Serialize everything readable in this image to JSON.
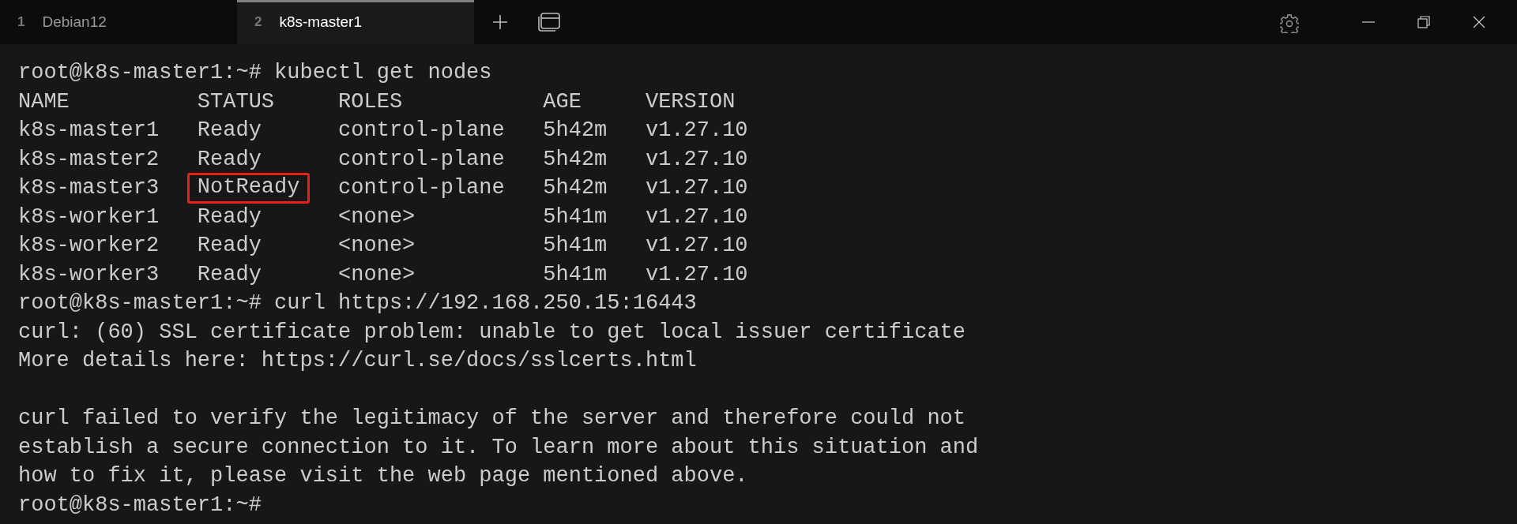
{
  "tabs": [
    {
      "number": "1",
      "title": "Debian12",
      "selected": false
    },
    {
      "number": "2",
      "title": "k8s-master1",
      "selected": true
    }
  ],
  "terminal": {
    "lines": [
      {
        "kind": "text",
        "segments": [
          {
            "text": "root@k8s-master1:~# kubectl get nodes",
            "highlighted": false
          }
        ]
      },
      {
        "kind": "text",
        "segments": [
          {
            "text": "NAME          STATUS     ROLES           AGE     VERSION",
            "highlighted": false
          }
        ]
      },
      {
        "kind": "text",
        "segments": [
          {
            "text": "k8s-master1   Ready      control-plane   5h42m   v1.27.10",
            "highlighted": false
          }
        ]
      },
      {
        "kind": "text",
        "segments": [
          {
            "text": "k8s-master2   Ready      control-plane   5h42m   v1.27.10",
            "highlighted": false
          }
        ]
      },
      {
        "kind": "text",
        "segments": [
          {
            "text": "k8s-master3   ",
            "highlighted": false
          },
          {
            "text": "NotReady",
            "highlighted": true
          },
          {
            "text": "   control-plane   5h42m   v1.27.10",
            "highlighted": false
          }
        ]
      },
      {
        "kind": "text",
        "segments": [
          {
            "text": "k8s-worker1   Ready      <none>          5h41m   v1.27.10",
            "highlighted": false
          }
        ]
      },
      {
        "kind": "text",
        "segments": [
          {
            "text": "k8s-worker2   Ready      <none>          5h41m   v1.27.10",
            "highlighted": false
          }
        ]
      },
      {
        "kind": "text",
        "segments": [
          {
            "text": "k8s-worker3   Ready      <none>          5h41m   v1.27.10",
            "highlighted": false
          }
        ]
      },
      {
        "kind": "text",
        "segments": [
          {
            "text": "root@k8s-master1:~# curl https://192.168.250.15:16443",
            "highlighted": false
          }
        ]
      },
      {
        "kind": "text",
        "segments": [
          {
            "text": "curl: (60) SSL certificate problem: unable to get local issuer certificate",
            "highlighted": false
          }
        ]
      },
      {
        "kind": "text",
        "segments": [
          {
            "text": "More details here: https://curl.se/docs/sslcerts.html",
            "highlighted": false
          }
        ]
      },
      {
        "kind": "blank"
      },
      {
        "kind": "text",
        "segments": [
          {
            "text": "curl failed to verify the legitimacy of the server and therefore could not",
            "highlighted": false
          }
        ]
      },
      {
        "kind": "text",
        "segments": [
          {
            "text": "establish a secure connection to it. To learn more about this situation and",
            "highlighted": false
          }
        ]
      },
      {
        "kind": "text",
        "segments": [
          {
            "text": "how to fix it, please visit the web page mentioned above.",
            "highlighted": false
          }
        ]
      },
      {
        "kind": "text",
        "segments": [
          {
            "text": "root@k8s-master1:~#",
            "highlighted": false
          }
        ]
      }
    ]
  }
}
